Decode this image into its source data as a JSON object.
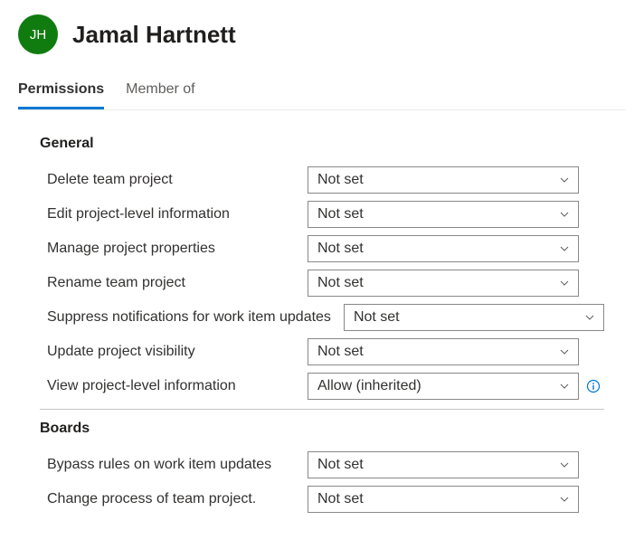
{
  "user": {
    "name": "Jamal Hartnett",
    "initials": "JH",
    "avatar_color": "#107c10"
  },
  "tabs": [
    {
      "label": "Permissions",
      "active": true
    },
    {
      "label": "Member of",
      "active": false
    }
  ],
  "sections": {
    "general": {
      "title": "General",
      "items": [
        {
          "label": "Delete team project",
          "value": "Not set"
        },
        {
          "label": "Edit project-level information",
          "value": "Not set"
        },
        {
          "label": "Manage project properties",
          "value": "Not set"
        },
        {
          "label": "Rename team project",
          "value": "Not set"
        },
        {
          "label": "Suppress notifications for work item updates",
          "value": "Not set",
          "wide": true
        },
        {
          "label": "Update project visibility",
          "value": "Not set"
        },
        {
          "label": "View project-level information",
          "value": "Allow (inherited)",
          "info": true
        }
      ]
    },
    "boards": {
      "title": "Boards",
      "items": [
        {
          "label": "Bypass rules on work item updates",
          "value": "Not set"
        },
        {
          "label": "Change process of team project.",
          "value": "Not set"
        }
      ]
    }
  },
  "colors": {
    "accent": "#0078d4",
    "info_icon": "#0078d4"
  }
}
